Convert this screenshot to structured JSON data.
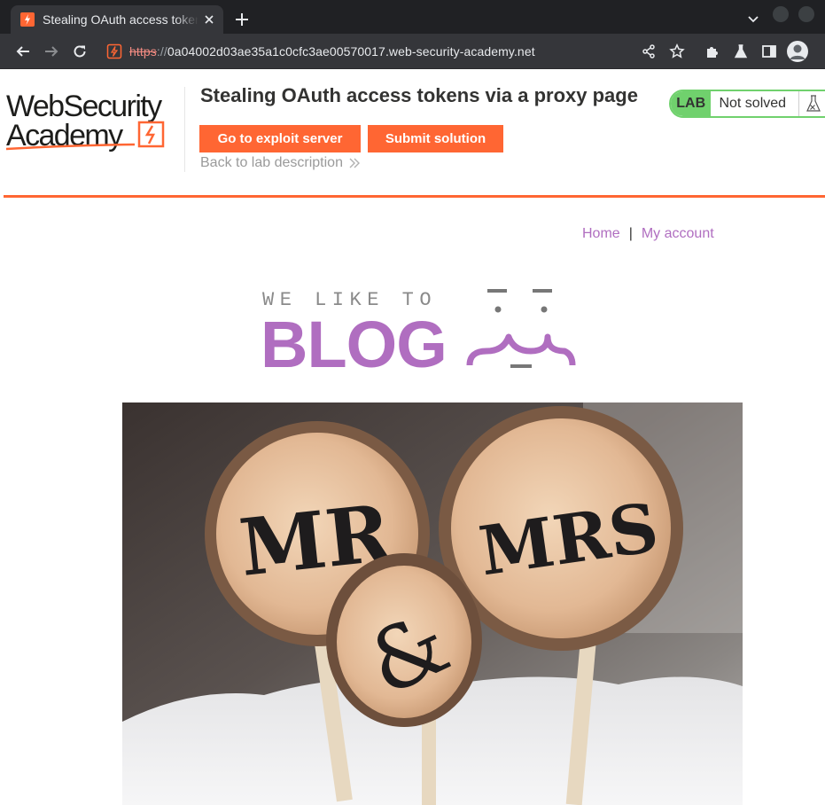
{
  "browser": {
    "tab_title": "Stealing OAuth access tokens via a proxy page",
    "url_scheme": "https",
    "url_separator": "://",
    "url_host": "0a04002d03ae35a1c0cfc3ae00570017.web-security-academy.net"
  },
  "lab": {
    "logo_alt": "Web Security Academy",
    "title": "Stealing OAuth access tokens via a proxy page",
    "exploit_button": "Go to exploit server",
    "submit_button": "Submit solution",
    "back_link": "Back to lab description",
    "status_tag": "LAB",
    "status_text": "Not solved",
    "accent_color": "#ff6633",
    "status_color": "#70d16d"
  },
  "blog": {
    "nav": {
      "home": "Home",
      "separator": "|",
      "account": "My account"
    },
    "banner_top": "WE LIKE TO",
    "banner_main": "BLOG",
    "link_color": "#b06ec0",
    "hero_image": {
      "sign_left": "MR",
      "sign_middle": "&",
      "sign_right": "MRS"
    }
  }
}
